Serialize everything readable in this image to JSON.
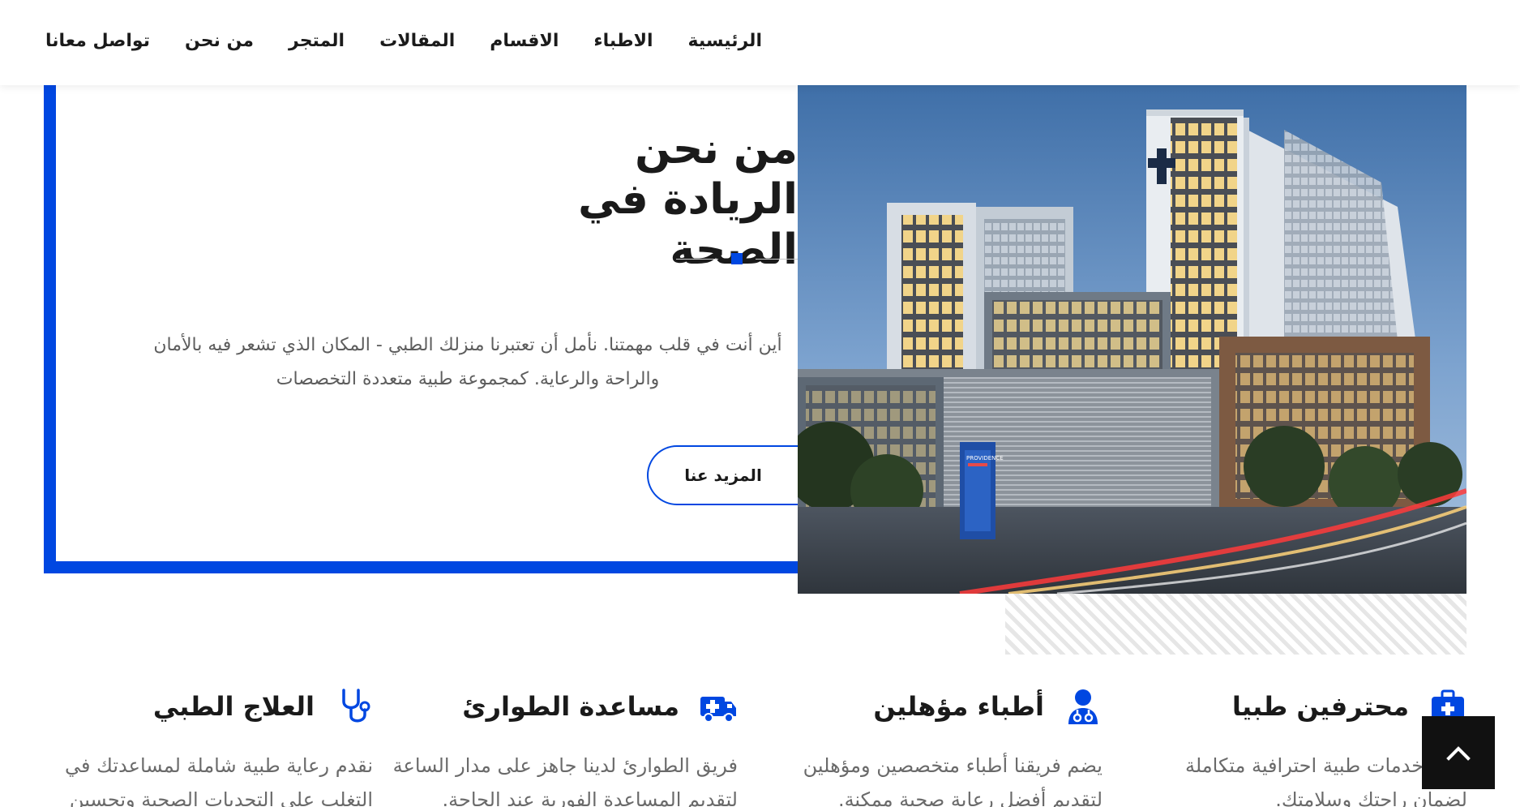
{
  "nav": {
    "items": [
      {
        "label": "الرئيسية"
      },
      {
        "label": "الاطباء"
      },
      {
        "label": "الاقسام"
      },
      {
        "label": "المقالات"
      },
      {
        "label": "المتجر"
      },
      {
        "label": "من نحن"
      },
      {
        "label": "تواصل معانا"
      }
    ]
  },
  "about": {
    "title_line1": "من نحن",
    "title_line2": "الريادة في الصحة",
    "text_line1": "أين أنت في قلب مهمتنا. نأمل أن تعتبرنا منزلك الطبي - المكان الذي تشعر فيه بالأمان",
    "text_line2": "والراحة والرعاية. كمجموعة طبية متعددة التخصصات",
    "more_button": "المزيد عنا",
    "accent_color": "#0047e1"
  },
  "hospital_image": {
    "sign_text": "PROVIDENCE"
  },
  "features": [
    {
      "icon": "medical-kit-icon",
      "title": "محترفين طبيا",
      "desc_line1": "نقدم خدمات طبية احترافية متكاملة",
      "desc_line2": "لضمان راحتك وسلامتك."
    },
    {
      "icon": "doctor-icon",
      "title": "أطباء مؤهلين",
      "desc_line1": "يضم فريقنا أطباء متخصصين ومؤهلين",
      "desc_line2": "لتقديم أفضل رعاية صحية ممكنة."
    },
    {
      "icon": "ambulance-icon",
      "title": "مساعدة الطوارئ",
      "desc_line1": "فريق الطوارئ لدينا جاهز على مدار الساعة",
      "desc_line2": "لتقديم المساعدة الفورية عند الحاجة."
    },
    {
      "icon": "stethoscope-icon",
      "title": "العلاج الطبي",
      "desc_line1": "نقدم رعاية طبية شاملة لمساعدتك في",
      "desc_line2": "التغلب على التحديات الصحية وتحسين"
    }
  ],
  "scroll_top": {
    "icon": "chevron-up-icon"
  }
}
